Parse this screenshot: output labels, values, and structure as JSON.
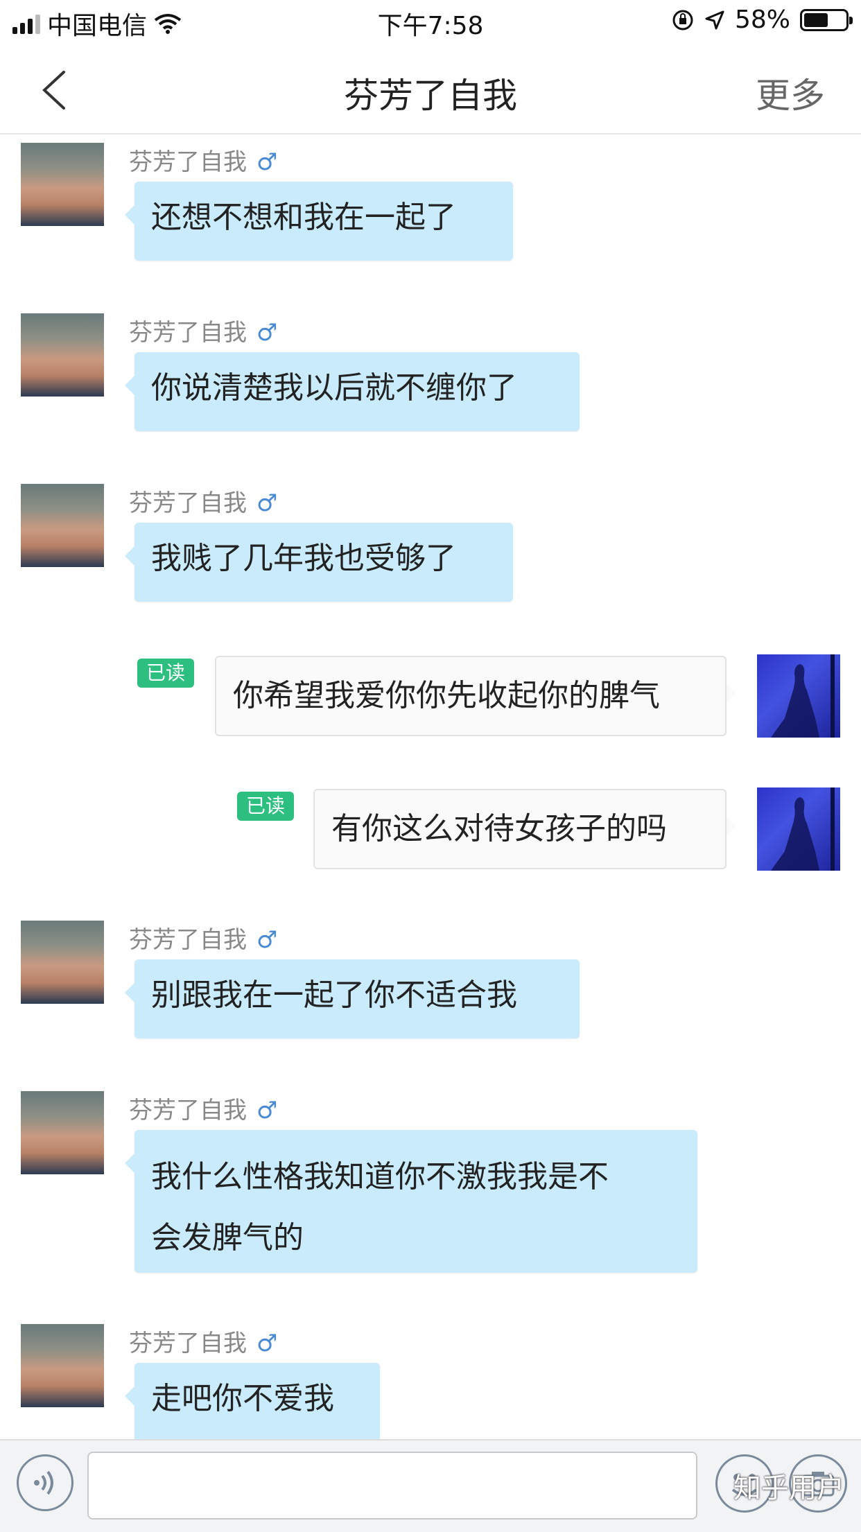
{
  "status_bar": {
    "carrier": "中国电信",
    "time": "下午7:58",
    "battery_percent": "58%",
    "battery_level": 0.58
  },
  "nav": {
    "title": "芬芳了自我",
    "more_label": "更多"
  },
  "messages": [
    {
      "side": "in",
      "sender": "芬芳了自我",
      "gender": "♂",
      "text": "还想不想和我在一起了"
    },
    {
      "side": "in",
      "sender": "芬芳了自我",
      "gender": "♂",
      "text": "你说清楚我以后就不缠你了"
    },
    {
      "side": "in",
      "sender": "芬芳了自我",
      "gender": "♂",
      "text": "我贱了几年我也受够了"
    },
    {
      "side": "out",
      "read": "已读",
      "text": "你希望我爱你你先收起你的脾气"
    },
    {
      "side": "out",
      "read": "已读",
      "text": "有你这么对待女孩子的吗"
    },
    {
      "side": "in",
      "sender": "芬芳了自我",
      "gender": "♂",
      "text": "别跟我在一起了你不适合我"
    },
    {
      "side": "in",
      "sender": "芬芳了自我",
      "gender": "♂",
      "text_line1": "我什么性格我知道你不激我我是不",
      "text_line2": "会发脾气的"
    },
    {
      "side": "in",
      "sender": "芬芳了自我",
      "gender": "♂",
      "text": "走吧你不爱我"
    }
  ],
  "toolbar": {
    "icons": [
      "voice-icon",
      "emoji-icon",
      "camera-icon"
    ],
    "watermark": "知乎用户"
  },
  "colors": {
    "incoming_bubble": "#c9ebfb",
    "read_badge": "#2dbf7f",
    "gender_male": "#4a8ad4"
  }
}
